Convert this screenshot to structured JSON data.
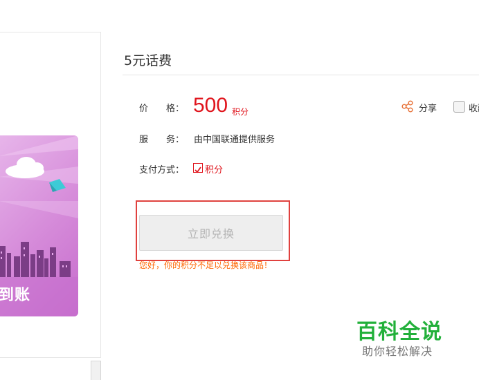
{
  "product": {
    "title": "5元话费",
    "image_banner_text": "到账"
  },
  "price": {
    "label": "价　　格：",
    "amount": "500",
    "unit": "积分"
  },
  "service": {
    "label": "服　　务：",
    "value": "由中国联通提供服务"
  },
  "payment": {
    "label": "支付方式：",
    "option": "积分",
    "checked": true
  },
  "actions": {
    "share_label": "分享",
    "favorite_label": "收藏"
  },
  "redeem": {
    "button_label": "立即兑换",
    "warning": "您好，你的积分不足以兑换该商品！"
  },
  "watermark": {
    "title": "百科全说",
    "subtitle": "助你轻松解决"
  },
  "colors": {
    "price_red": "#e0141c",
    "warning_orange": "#ff6600",
    "highlight_border": "#e0413e",
    "watermark_green": "#22b03a",
    "card_purple": "#d58ad9"
  }
}
